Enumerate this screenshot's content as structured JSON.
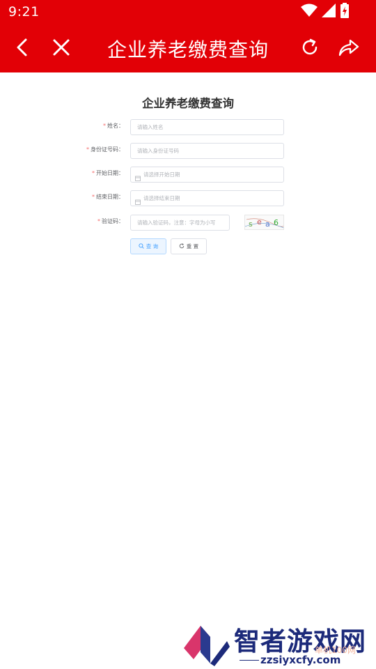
{
  "status_bar": {
    "time": "9:21",
    "icons": [
      "wifi-icon",
      "signal-icon",
      "battery-charging-icon"
    ]
  },
  "app_bar": {
    "title": "企业养老缴费查询",
    "icons": [
      "back-icon",
      "close-icon",
      "refresh-icon",
      "share-icon"
    ],
    "color": "#e20006"
  },
  "form": {
    "title": "企业养老缴费查询",
    "fields": [
      {
        "label": "姓名：",
        "placeholder": "请输入姓名",
        "required": true
      },
      {
        "label": "身份证号码：",
        "placeholder": "请输入身份证号码",
        "required": true
      },
      {
        "label": "开始日期：",
        "placeholder": "请选择开始日期",
        "required": true
      },
      {
        "label": "结束日期：",
        "placeholder": "请选择结束日期",
        "required": true
      },
      {
        "label": "验证码：",
        "placeholder": "请输入验证码，注意：字母为小写",
        "required": true
      }
    ],
    "required_mark": "*",
    "query_button": "查 询",
    "reset_button": "重 置",
    "accent_color": "#409eff"
  },
  "watermark": {
    "text": "智者游戏网",
    "url": "zzsiyxcfy.com",
    "sub": "单机100网"
  }
}
